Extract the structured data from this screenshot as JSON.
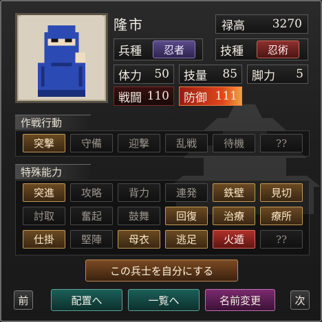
{
  "unit": {
    "name": "隆市",
    "stipend_label": "禄高",
    "stipend_value": "3270",
    "troop_label": "兵種",
    "troop_value": "忍者",
    "tech_label": "技種",
    "tech_value": "忍術",
    "stats": {
      "hp_label": "体力",
      "hp_value": "50",
      "skill_label": "技量",
      "skill_value": "85",
      "leg_label": "脚力",
      "leg_value": "5",
      "atk_label": "戦闘",
      "atk_value": "110",
      "def_label": "防御",
      "def_value": "111"
    }
  },
  "tactics": {
    "title": "作戦行動",
    "items": [
      {
        "label": "突撃",
        "state": "on"
      },
      {
        "label": "守備",
        "state": "off"
      },
      {
        "label": "迎撃",
        "state": "off"
      },
      {
        "label": "乱戦",
        "state": "off"
      },
      {
        "label": "待機",
        "state": "off"
      },
      {
        "label": "??",
        "state": "off"
      }
    ]
  },
  "abilities": {
    "title": "特殊能力",
    "items": [
      {
        "label": "突進",
        "state": "on"
      },
      {
        "label": "攻略",
        "state": "off"
      },
      {
        "label": "背力",
        "state": "off"
      },
      {
        "label": "連発",
        "state": "off"
      },
      {
        "label": "鉄壁",
        "state": "on"
      },
      {
        "label": "見切",
        "state": "on"
      },
      {
        "label": "討取",
        "state": "off"
      },
      {
        "label": "奮起",
        "state": "off"
      },
      {
        "label": "鼓舞",
        "state": "off"
      },
      {
        "label": "回復",
        "state": "on"
      },
      {
        "label": "治療",
        "state": "on"
      },
      {
        "label": "療所",
        "state": "on"
      },
      {
        "label": "仕掛",
        "state": "on"
      },
      {
        "label": "堅陣",
        "state": "off"
      },
      {
        "label": "母衣",
        "state": "on"
      },
      {
        "label": "逃足",
        "state": "on"
      },
      {
        "label": "火遁",
        "state": "red"
      },
      {
        "label": "??",
        "state": "off"
      }
    ]
  },
  "actions": {
    "make_own": "この兵士を自分にする",
    "prev": "前",
    "next": "次",
    "deploy": "配置へ",
    "list": "一覧へ",
    "rename": "名前変更"
  }
}
